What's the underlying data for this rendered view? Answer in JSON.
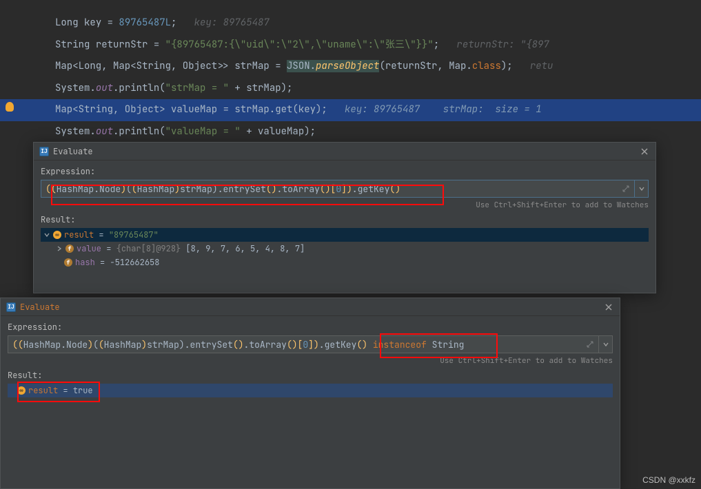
{
  "editor": {
    "line1": {
      "type": "Long",
      "var": "key",
      "eq": " = ",
      "num": "89765487L",
      "sc": ";",
      "hint": "   key: 89765487"
    },
    "line2": {
      "type": "String",
      "var": "returnStr",
      "eq": " = ",
      "str": "\"{89765487:{\\\"uid\\\":\\\"2\\\",\\\"uname\\\":\\\"张三\\\"}}\"",
      "sc": ";",
      "hint": "   returnStr: \"{897"
    },
    "line3": {
      "pre": "Map<Long, Map<String, Object>> ",
      "var": "strMap",
      "eq": " = ",
      "json1": "JSON",
      "jsondot": ".",
      "json2": "parseObject",
      "args": "(returnStr, Map.",
      "cls": "class",
      "argsend": ");",
      "hint": "   retu"
    },
    "line4": {
      "pre": "System.",
      "out": "out",
      "println": ".println(",
      "str": "\"strMap = \"",
      "plus": " + strMap);"
    },
    "line5": {
      "pre": "Map<String, Object> ",
      "var": "valueMap",
      "eq": " = ",
      "call": "strMap.get(key)",
      "sc": ";",
      "hint": "   key: 89765487    strMap:  size = 1"
    },
    "line6": {
      "pre": "System.",
      "out": "out",
      "println": ".println(",
      "str": "\"valueMap = \"",
      "plus": " + valueMap);"
    }
  },
  "panel1": {
    "title": "Evaluate",
    "expr_label": "Expression:",
    "expr": {
      "p1": "(",
      "p2": "(",
      "t1": "HashMap.Node",
      "p3": ")",
      "p4": "(",
      "p5": "(",
      "t2": "HashMap",
      "p6": ")",
      "v1": "strMap",
      "p7": ")",
      "m1": ".entrySet",
      "pp1": "()",
      "m2": ".toArray",
      "pp2": "()",
      "br1": "[",
      "idx": "0",
      "br2": "]",
      "p8": ")",
      "m3": ".getKey",
      "pp3": "()"
    },
    "hint": "Use Ctrl+Shift+Enter to add to Watches",
    "result_label": "Result:",
    "row1": {
      "name": "result",
      "eq": " = ",
      "val": "\"89765487\""
    },
    "row2": {
      "name": "value",
      "eq": " = ",
      "dim": "{char[8]@928}",
      "arr": " [8, 9, 7, 6, 5, 4, 8, 7]"
    },
    "row3": {
      "name": "hash",
      "eq": " = ",
      "val": "-512662658"
    }
  },
  "panel2": {
    "title": "Evaluate",
    "expr_label": "Expression:",
    "expr": {
      "p1": "(",
      "p2": "(",
      "t1": "HashMap.Node",
      "p3": ")",
      "p4": "(",
      "p5": "(",
      "t2": "HashMap",
      "p6": ")",
      "v1": "strMap",
      "p7": ")",
      "m1": ".entrySet",
      "pp1": "()",
      "m2": ".toArray",
      "pp2": "()",
      "br1": "[",
      "idx": "0",
      "br2": "]",
      "p8": ")",
      "m3": ".getKey",
      "pp3": "() ",
      "inst": "instanceof",
      "sp": " ",
      "cls": "String"
    },
    "hint": "Use Ctrl+Shift+Enter to add to Watches",
    "result_label": "Result:",
    "row1": {
      "name": "result",
      "eq": " = ",
      "val": "true"
    }
  },
  "watermark": "CSDN @xxkfz"
}
